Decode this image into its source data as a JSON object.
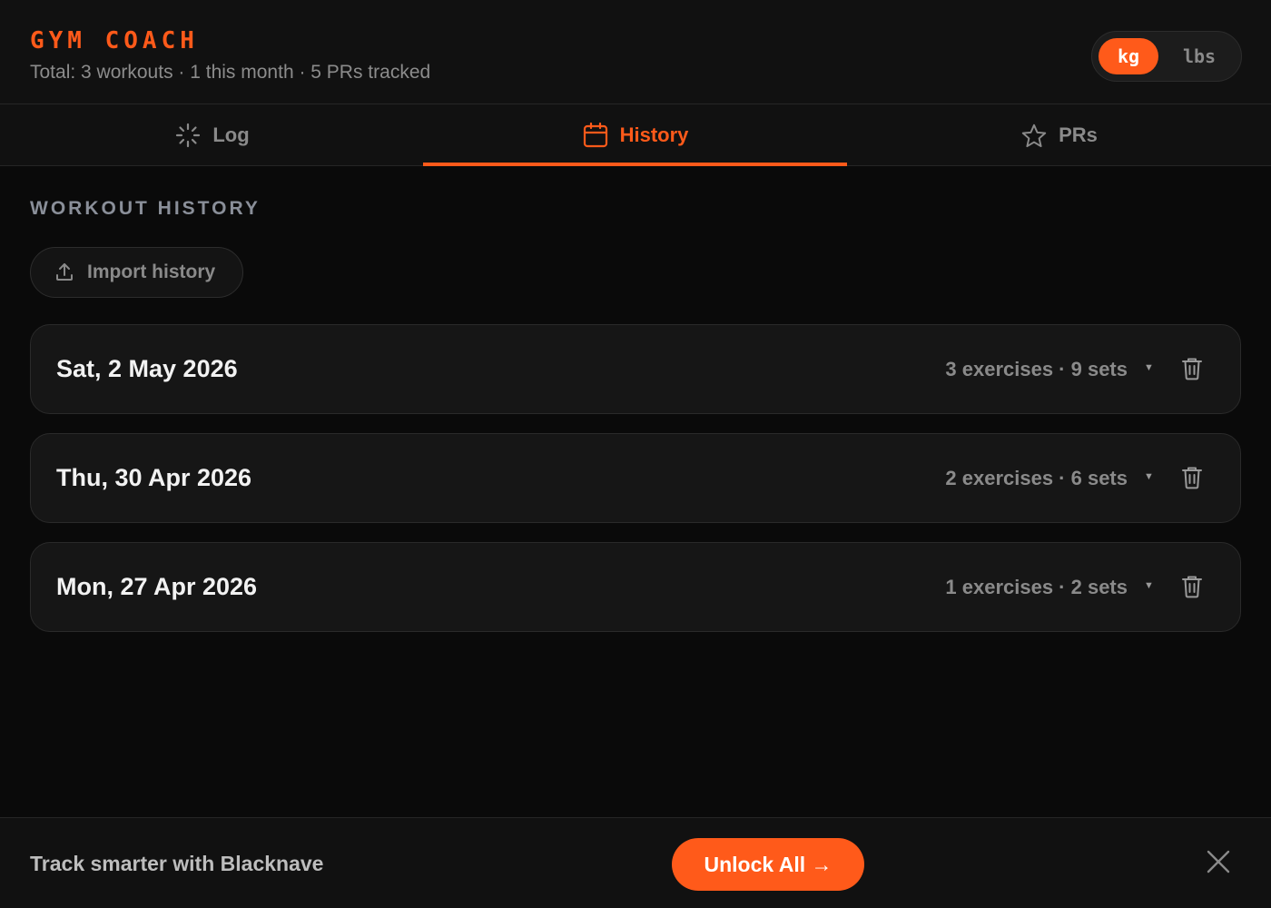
{
  "app": {
    "title": "GYM COACH",
    "stats": "Total: 3 workouts · 1 this month · 5 PRs tracked"
  },
  "units": {
    "options": [
      "kg",
      "lbs"
    ],
    "selected": "kg"
  },
  "tabs": [
    {
      "label": "Log",
      "icon": "loader-icon",
      "active": false
    },
    {
      "label": "History",
      "icon": "calendar-icon",
      "active": true
    },
    {
      "label": "PRs",
      "icon": "star-icon",
      "active": false
    }
  ],
  "history": {
    "section_title": "WORKOUT HISTORY",
    "import_label": "Import history",
    "import_icon": "upload-icon",
    "workouts": [
      {
        "date": "Sat, 2 May 2026",
        "summary": "3 exercises · 9 sets"
      },
      {
        "date": "Thu, 30 Apr 2026",
        "summary": "2 exercises · 6 sets"
      },
      {
        "date": "Mon, 27 Apr 2026",
        "summary": "1 exercises · 2 sets"
      }
    ]
  },
  "footer": {
    "promo_text": "Track smarter with Blacknave",
    "cta_label": "Unlock All →"
  },
  "colors": {
    "accent": "#ff5a1a",
    "background": "#0a0a0a",
    "surface": "#161616"
  }
}
